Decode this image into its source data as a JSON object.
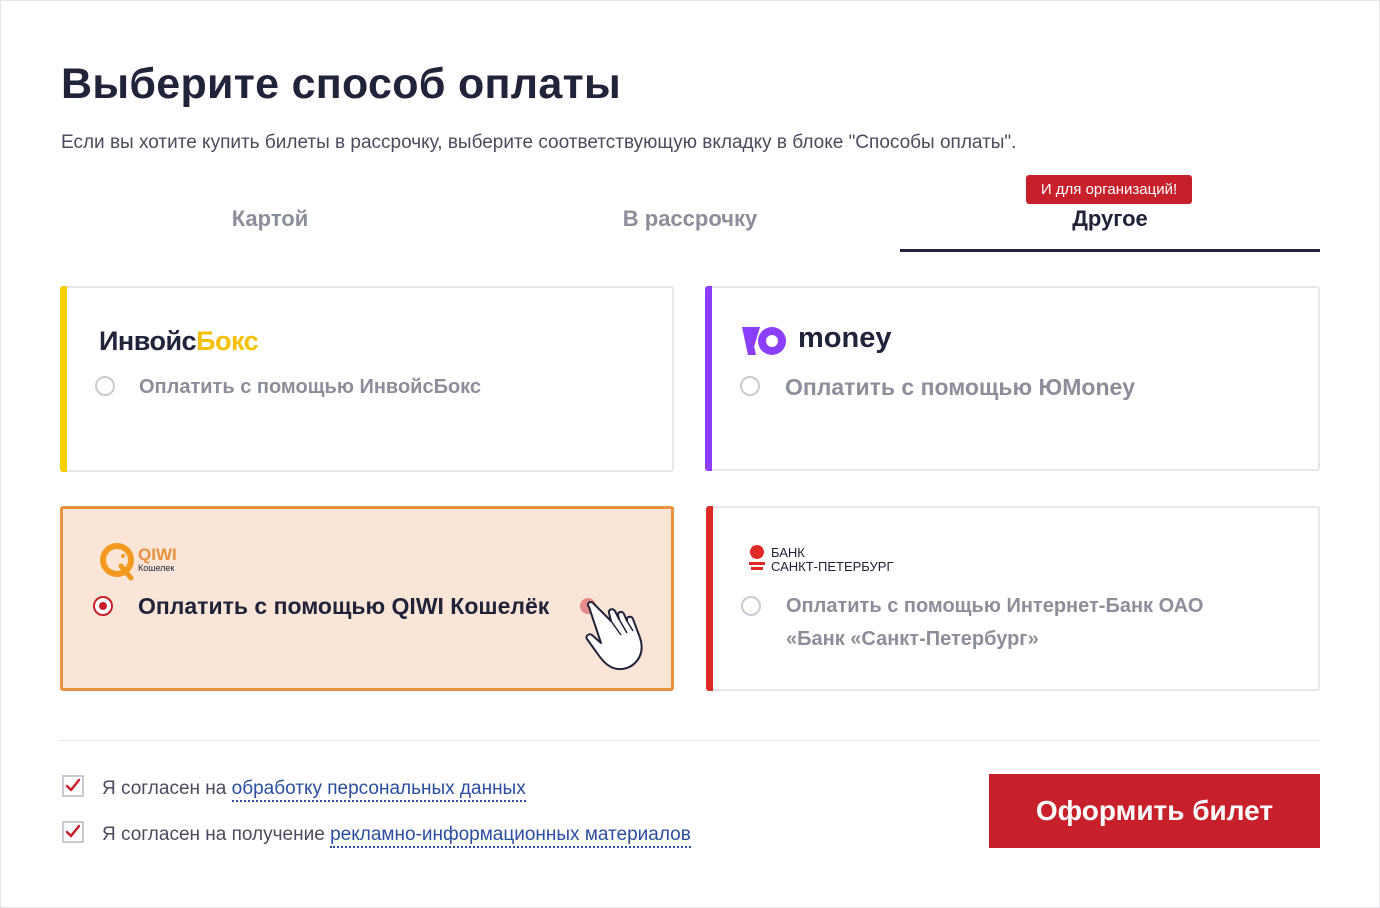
{
  "page": {
    "title": "Выберите способ оплаты",
    "subtitle": "Если вы хотите купить билеты в рассрочку, выберите соответствующую вкладку в блоке \"Способы оплаты\"."
  },
  "tabs": [
    {
      "label": "Картой",
      "active": false
    },
    {
      "label": "В рассрочку",
      "active": false
    },
    {
      "label": "Другое",
      "active": true,
      "badge": "И для организаций!"
    }
  ],
  "methods": [
    {
      "logo_part1": "Инвойс",
      "logo_part2": "Бокс",
      "label": "Оплатить с помощью ИнвойсБокс",
      "selected": false,
      "accent": "#f6d000"
    },
    {
      "logo_text": "money",
      "label": "Оплатить с помощью ЮMoney",
      "selected": false,
      "accent": "#8b3ffd"
    },
    {
      "logo_text": "QIWI",
      "logo_sub": "Кошелек",
      "label": "Оплатить с помощью QIWI Кошелёк",
      "selected": true,
      "accent": "#e8913e"
    },
    {
      "logo_line1": "БАНК",
      "logo_line2": "САНКТ-ПЕТЕРБУРГ",
      "label_line1": "Оплатить с помощью Интернет-Банк ОАО",
      "label_line2": "«Банк «Санкт-Петербург»",
      "selected": false,
      "accent": "#e02a26"
    }
  ],
  "consents": [
    {
      "prefix": "Я согласен на ",
      "link": "обработку персональных данных",
      "checked": true
    },
    {
      "prefix": "Я согласен на получение ",
      "link": "рекламно-информационных материалов",
      "checked": true
    }
  ],
  "submit_label": "Оформить билет",
  "icons": {
    "check": "check-icon",
    "cursor": "hand-pointer-icon"
  }
}
